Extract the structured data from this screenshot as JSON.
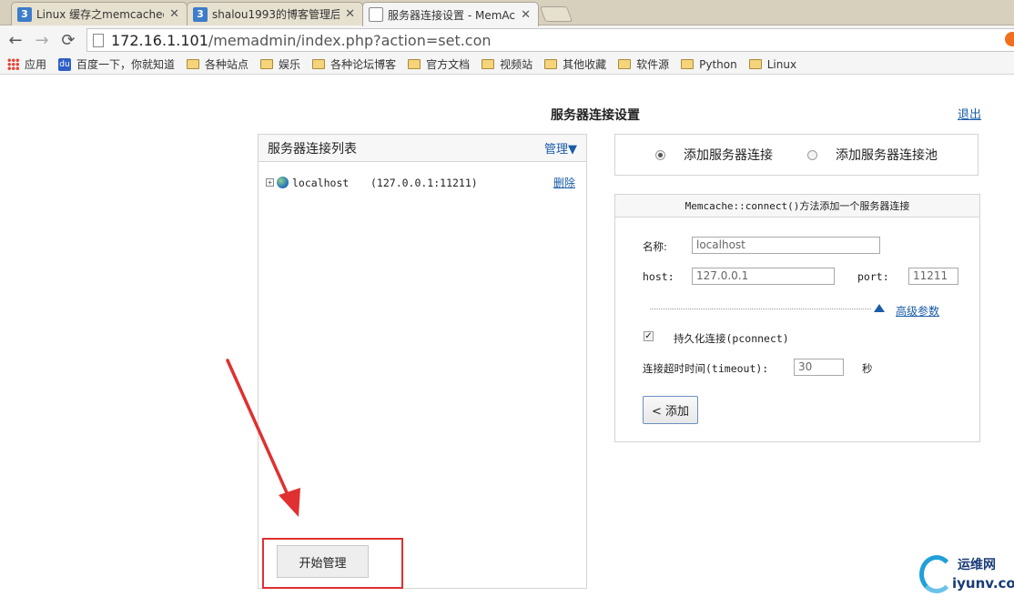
{
  "browser": {
    "tabs": [
      {
        "icon": "3",
        "title": "Linux 缓存之memcached",
        "close": "✕"
      },
      {
        "icon": "3",
        "title": "shalou1993的博客管理后",
        "close": "✕"
      },
      {
        "icon": "",
        "title": "服务器连接设置 - MemAc",
        "close": "✕"
      }
    ],
    "url_host": "172.16.1.101",
    "url_path": "/memadmin/index.php?action=set.con",
    "bookmarks": [
      "应用",
      "百度一下，你就知道",
      "各种站点",
      "娱乐",
      "各种论坛博客",
      "官方文档",
      "视频站",
      "其他收藏",
      "软件源",
      "Python",
      "Linux"
    ]
  },
  "page": {
    "title": "服务器连接设置",
    "logout": "退出"
  },
  "server_list": {
    "title": "服务器连接列表",
    "manage": "管理▼",
    "servers": [
      {
        "name": "localhost",
        "address": "(127.0.0.1:11211)",
        "delete": "删除"
      }
    ],
    "start_button": "开始管理"
  },
  "mode": {
    "option_connect": "添加服务器连接",
    "option_pool": "添加服务器连接池"
  },
  "form": {
    "heading": "Memcache::connect()方法添加一个服务器连接",
    "name_label": "名称:",
    "name_value": "localhost",
    "host_label": "host:",
    "host_value": "127.0.0.1",
    "port_label": "port:",
    "port_value": "11211",
    "advanced": "高级参数",
    "persistent_label": "持久化连接(pconnect)",
    "timeout_label": "连接超时时间(timeout):",
    "timeout_value": "30",
    "timeout_unit": "秒",
    "add_button": "< 添加"
  },
  "watermark": {
    "line1": "运维网",
    "line2": "iyunv.com"
  },
  "colors": {
    "link": "#1a5ca8",
    "annotation": "#e03030"
  }
}
